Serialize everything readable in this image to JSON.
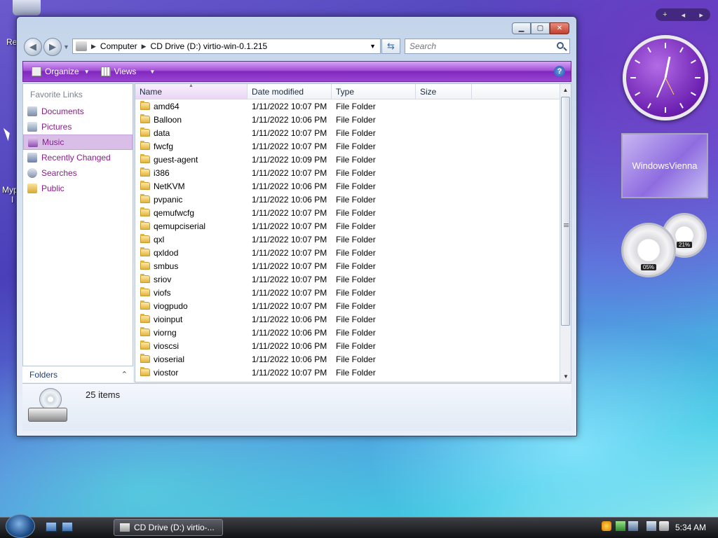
{
  "desktop": {
    "frag_re": "Re",
    "frag_my": "Myp",
    "frag_i": "I"
  },
  "window": {
    "address": {
      "segments": [
        "Computer",
        "CD Drive (D:) virtio-win-0.1.215"
      ]
    },
    "search": {
      "placeholder": "Search"
    },
    "toolbar": {
      "organize_label": "Organize",
      "views_label": "Views",
      "help_glyph": "?"
    },
    "nav_pane": {
      "header": "Favorite Links",
      "items": [
        {
          "label": "Documents",
          "icon": "documents-icon"
        },
        {
          "label": "Pictures",
          "icon": "pictures-icon"
        },
        {
          "label": "Music",
          "icon": "music-icon",
          "selected": true
        },
        {
          "label": "Recently Changed",
          "icon": "recently-changed-icon"
        },
        {
          "label": "Searches",
          "icon": "searches-icon"
        },
        {
          "label": "Public",
          "icon": "public-icon"
        }
      ],
      "folders_label": "Folders"
    },
    "columns": {
      "name": "Name",
      "date": "Date modified",
      "type": "Type",
      "size": "Size"
    },
    "files": [
      {
        "name": "amd64",
        "date": "1/11/2022 10:07 PM",
        "type": "File Folder"
      },
      {
        "name": "Balloon",
        "date": "1/11/2022 10:06 PM",
        "type": "File Folder"
      },
      {
        "name": "data",
        "date": "1/11/2022 10:07 PM",
        "type": "File Folder"
      },
      {
        "name": "fwcfg",
        "date": "1/11/2022 10:07 PM",
        "type": "File Folder"
      },
      {
        "name": "guest-agent",
        "date": "1/11/2022 10:09 PM",
        "type": "File Folder"
      },
      {
        "name": "i386",
        "date": "1/11/2022 10:07 PM",
        "type": "File Folder"
      },
      {
        "name": "NetKVM",
        "date": "1/11/2022 10:06 PM",
        "type": "File Folder"
      },
      {
        "name": "pvpanic",
        "date": "1/11/2022 10:06 PM",
        "type": "File Folder"
      },
      {
        "name": "qemufwcfg",
        "date": "1/11/2022 10:07 PM",
        "type": "File Folder"
      },
      {
        "name": "qemupciserial",
        "date": "1/11/2022 10:07 PM",
        "type": "File Folder"
      },
      {
        "name": "qxl",
        "date": "1/11/2022 10:07 PM",
        "type": "File Folder"
      },
      {
        "name": "qxldod",
        "date": "1/11/2022 10:07 PM",
        "type": "File Folder"
      },
      {
        "name": "smbus",
        "date": "1/11/2022 10:07 PM",
        "type": "File Folder"
      },
      {
        "name": "sriov",
        "date": "1/11/2022 10:07 PM",
        "type": "File Folder"
      },
      {
        "name": "viofs",
        "date": "1/11/2022 10:07 PM",
        "type": "File Folder"
      },
      {
        "name": "viogpudo",
        "date": "1/11/2022 10:07 PM",
        "type": "File Folder"
      },
      {
        "name": "vioinput",
        "date": "1/11/2022 10:06 PM",
        "type": "File Folder"
      },
      {
        "name": "viorng",
        "date": "1/11/2022 10:06 PM",
        "type": "File Folder"
      },
      {
        "name": "vioscsi",
        "date": "1/11/2022 10:06 PM",
        "type": "File Folder"
      },
      {
        "name": "vioserial",
        "date": "1/11/2022 10:06 PM",
        "type": "File Folder"
      },
      {
        "name": "viostor",
        "date": "1/11/2022 10:07 PM",
        "type": "File Folder"
      }
    ],
    "details": {
      "items_count": "25 items"
    }
  },
  "gadgets": {
    "slideshow_text": "WindowsVienna",
    "cpu_percent": "05%",
    "mem_percent": "21%"
  },
  "taskbar": {
    "task_label": "CD Drive (D:) virtio-...",
    "clock": "5:34 AM"
  },
  "colors": {
    "toolbar_purple": "#9a44d2",
    "nav_link": "#8a1d8a",
    "selected_bg": "#d9bfe8"
  }
}
